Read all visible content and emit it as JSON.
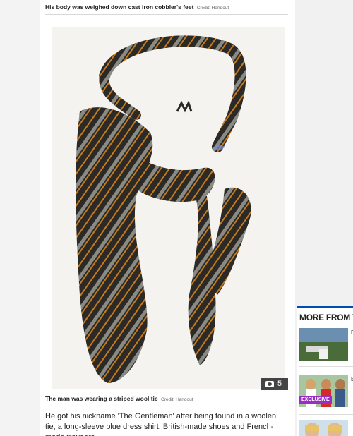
{
  "captions": {
    "top": "His body was weighed down cast iron cobbler's feet",
    "top_credit": "Credit: Handout",
    "bottom": "The man was wearing a striped wool tie",
    "bottom_credit": "Credit: Handout"
  },
  "gallery": {
    "count": "5",
    "icon": "camera-icon"
  },
  "article": {
    "body": "He got his nickname 'The Gentleman' after being found in a woolen tie, a long-sleeve blue dress shirt, British-made shoes and French-made trousers"
  },
  "sidebar": {
    "title": "MORE FROM TH",
    "items": [
      {
        "snippet": "D",
        "badge": ""
      },
      {
        "snippet": "E",
        "badge": "EXCLUSIVE"
      },
      {
        "snippet": "",
        "badge": ""
      }
    ]
  },
  "colors": {
    "accent": "#004db3",
    "exclusive": "#9b2cc4"
  }
}
